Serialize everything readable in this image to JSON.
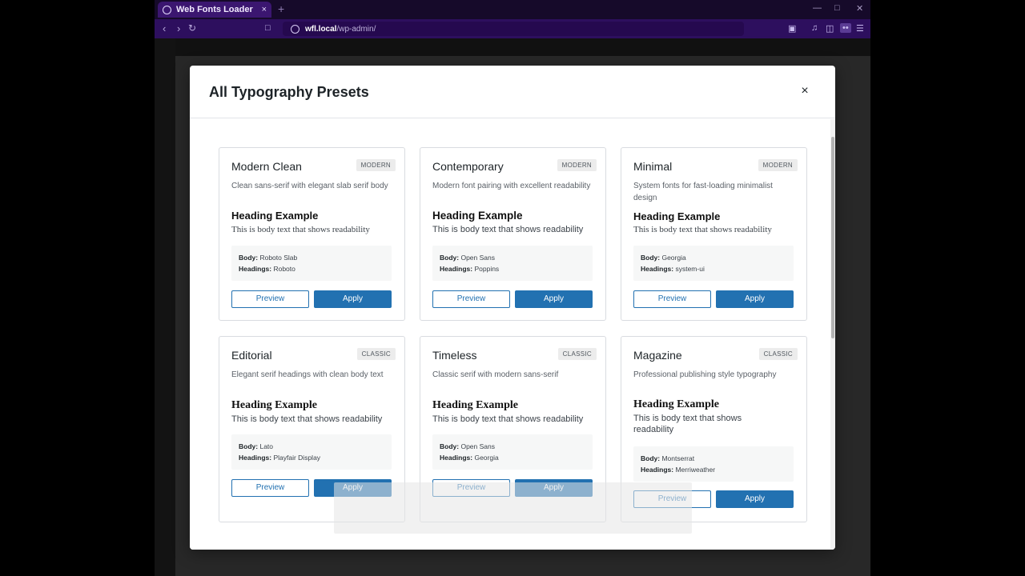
{
  "browser": {
    "tab_title": "Web Fonts Loader",
    "tab_close": "×",
    "new_tab": "+",
    "url_host": "wfl.local",
    "url_path": "/wp-admin/"
  },
  "modal": {
    "title": "All Typography Presets",
    "close_label": "×"
  },
  "labels": {
    "body": "Body:",
    "headings": "Headings:",
    "preview": "Preview",
    "apply": "Apply",
    "heading_example": "Heading Example",
    "body_example": "This is body text that shows readability"
  },
  "presets": [
    {
      "name": "Modern Clean",
      "badge": "MODERN",
      "description": "Clean sans-serif with elegant slab serif body",
      "body_font": "Roboto Slab",
      "heading_font": "Roboto"
    },
    {
      "name": "Contemporary",
      "badge": "MODERN",
      "description": "Modern font pairing with excellent readability",
      "body_font": "Open Sans",
      "heading_font": "Poppins"
    },
    {
      "name": "Minimal",
      "badge": "MODERN",
      "description": "System fonts for fast-loading minimalist design",
      "body_font": "Georgia",
      "heading_font": "system-ui"
    },
    {
      "name": "Editorial",
      "badge": "CLASSIC",
      "description": "Elegant serif headings with clean body text",
      "body_font": "Lato",
      "heading_font": "Playfair Display"
    },
    {
      "name": "Timeless",
      "badge": "CLASSIC",
      "description": "Classic serif with modern sans-serif",
      "body_font": "Open Sans",
      "heading_font": "Georgia"
    },
    {
      "name": "Magazine",
      "badge": "CLASSIC",
      "description": "Professional publishing style typography",
      "body_font": "Montserrat",
      "heading_font": "Merriweather"
    }
  ]
}
